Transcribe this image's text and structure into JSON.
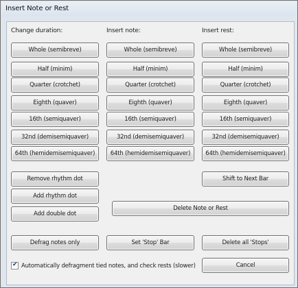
{
  "window": {
    "title": "Insert Note or Rest"
  },
  "columns": {
    "change_duration": {
      "label": "Change duration:",
      "buttons": [
        "Whole (semibreve)",
        "Half (minim)",
        "Quarter (crotchet)",
        "Eighth (quaver)",
        "16th (semiquaver)",
        "32nd (demisemiquaver)",
        "64th (hemidemisemiquaver)"
      ]
    },
    "insert_note": {
      "label": "Insert note:",
      "buttons": [
        "Whole (semibreve)",
        "Half (minim)",
        "Quarter (crotchet)",
        "Eighth (quaver)",
        "16th (semiquaver)",
        "32nd (demisemiquaver)",
        "64th (hemidemisemiquaver)"
      ]
    },
    "insert_rest": {
      "label": "Insert rest:",
      "buttons": [
        "Whole (semibreve)",
        "Half (minim)",
        "Quarter (crotchet)",
        "Eighth (quaver)",
        "16th (semiquaver)",
        "32nd (demisemiquaver)",
        "64th (hemidemisemiquaver)"
      ]
    }
  },
  "actions": {
    "remove_rhythm_dot": "Remove rhythm dot",
    "shift_to_next_bar": "Shift to Next Bar",
    "add_rhythm_dot": "Add rhythm dot",
    "add_double_dot": "Add double dot",
    "delete_note_or_rest": "Delete Note or Rest",
    "defrag_notes_only": "Defrag notes only",
    "set_stop_bar": "Set 'Stop' Bar",
    "delete_all_stops": "Delete all 'Stops'",
    "cancel": "Cancel"
  },
  "auto_defrag": {
    "label": "Automatically defragment tied notes, and check rests (slower)",
    "checked": true
  }
}
